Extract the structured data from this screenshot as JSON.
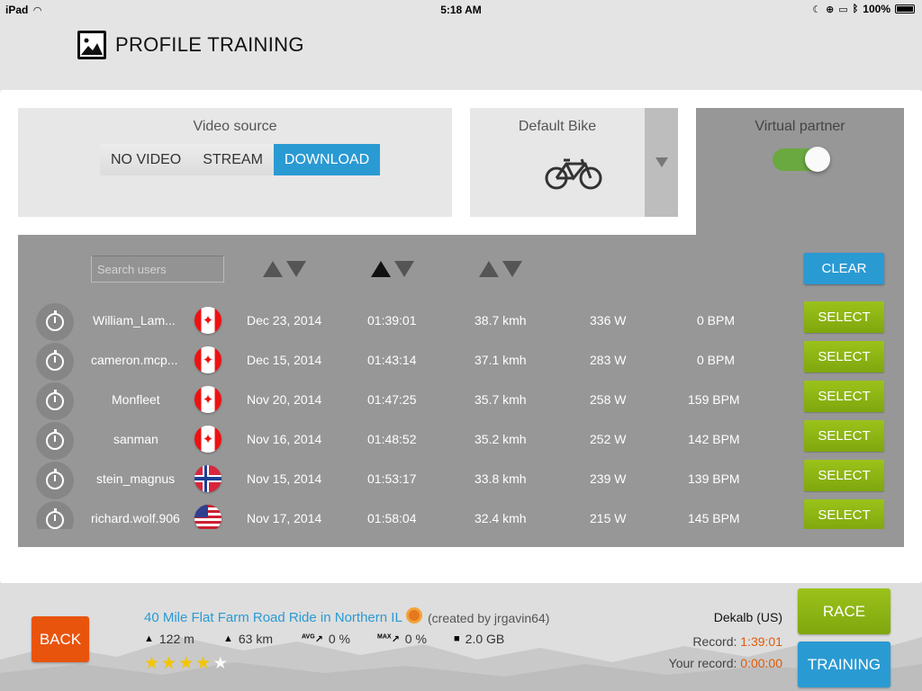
{
  "status_bar": {
    "device": "iPad",
    "time": "5:18 AM",
    "battery": "100%"
  },
  "header": {
    "title": "PROFILE TRAINING",
    "icon": "image-icon"
  },
  "video_source": {
    "label": "Video source",
    "options": [
      "NO VIDEO",
      "STREAM",
      "DOWNLOAD"
    ],
    "selected": "DOWNLOAD"
  },
  "bike": {
    "label": "Default Bike",
    "icon": "bicycle-icon"
  },
  "virtual_partner": {
    "label": "Virtual partner",
    "enabled": true
  },
  "search": {
    "placeholder": "Search users"
  },
  "clear_label": "CLEAR",
  "select_label": "SELECT",
  "rows": [
    {
      "user": "William_Lam...",
      "flag": "canada",
      "date": "Dec 23, 2014",
      "time": "01:39:01",
      "speed": "38.7 kmh",
      "power": "336 W",
      "hr": "0 BPM"
    },
    {
      "user": "cameron.mcp...",
      "flag": "canada",
      "date": "Dec 15, 2014",
      "time": "01:43:14",
      "speed": "37.1 kmh",
      "power": "283 W",
      "hr": "0 BPM"
    },
    {
      "user": "Monfleet",
      "flag": "canada",
      "date": "Nov 20, 2014",
      "time": "01:47:25",
      "speed": "35.7 kmh",
      "power": "258 W",
      "hr": "159 BPM"
    },
    {
      "user": "sanman",
      "flag": "canada",
      "date": "Nov 16, 2014",
      "time": "01:48:52",
      "speed": "35.2 kmh",
      "power": "252 W",
      "hr": "142 BPM"
    },
    {
      "user": "stein_magnus",
      "flag": "norway",
      "date": "Nov 15, 2014",
      "time": "01:53:17",
      "speed": "33.8 kmh",
      "power": "239 W",
      "hr": "139 BPM"
    },
    {
      "user": "richard.wolf.906",
      "flag": "usa",
      "date": "Nov 17, 2014",
      "time": "01:58:04",
      "speed": "32.4 kmh",
      "power": "215 W",
      "hr": "145 BPM"
    }
  ],
  "bottom": {
    "back_label": "BACK",
    "route_title": "40 Mile Flat Farm Road Ride in Northern IL",
    "created_by": "(created by jrgavin64)",
    "elevation": "122 m",
    "distance": "63 km",
    "avg_slope_tag": "AVG",
    "avg_slope": "0 %",
    "max_slope_tag": "MAX",
    "max_slope": "0 %",
    "size": "2.0 GB",
    "rating": 4,
    "rating_max": 5,
    "location": "Dekalb (US)",
    "record_label": "Record:",
    "record_value": "1:39:01",
    "your_record_label": "Your record:",
    "your_record_value": "0:00:00",
    "race_label": "RACE",
    "training_label": "TRAINING"
  },
  "colors": {
    "accent_blue": "#2a9ad3",
    "select_green": "#8db514",
    "back_orange": "#e9540d",
    "record_orange": "#e05a0a"
  }
}
